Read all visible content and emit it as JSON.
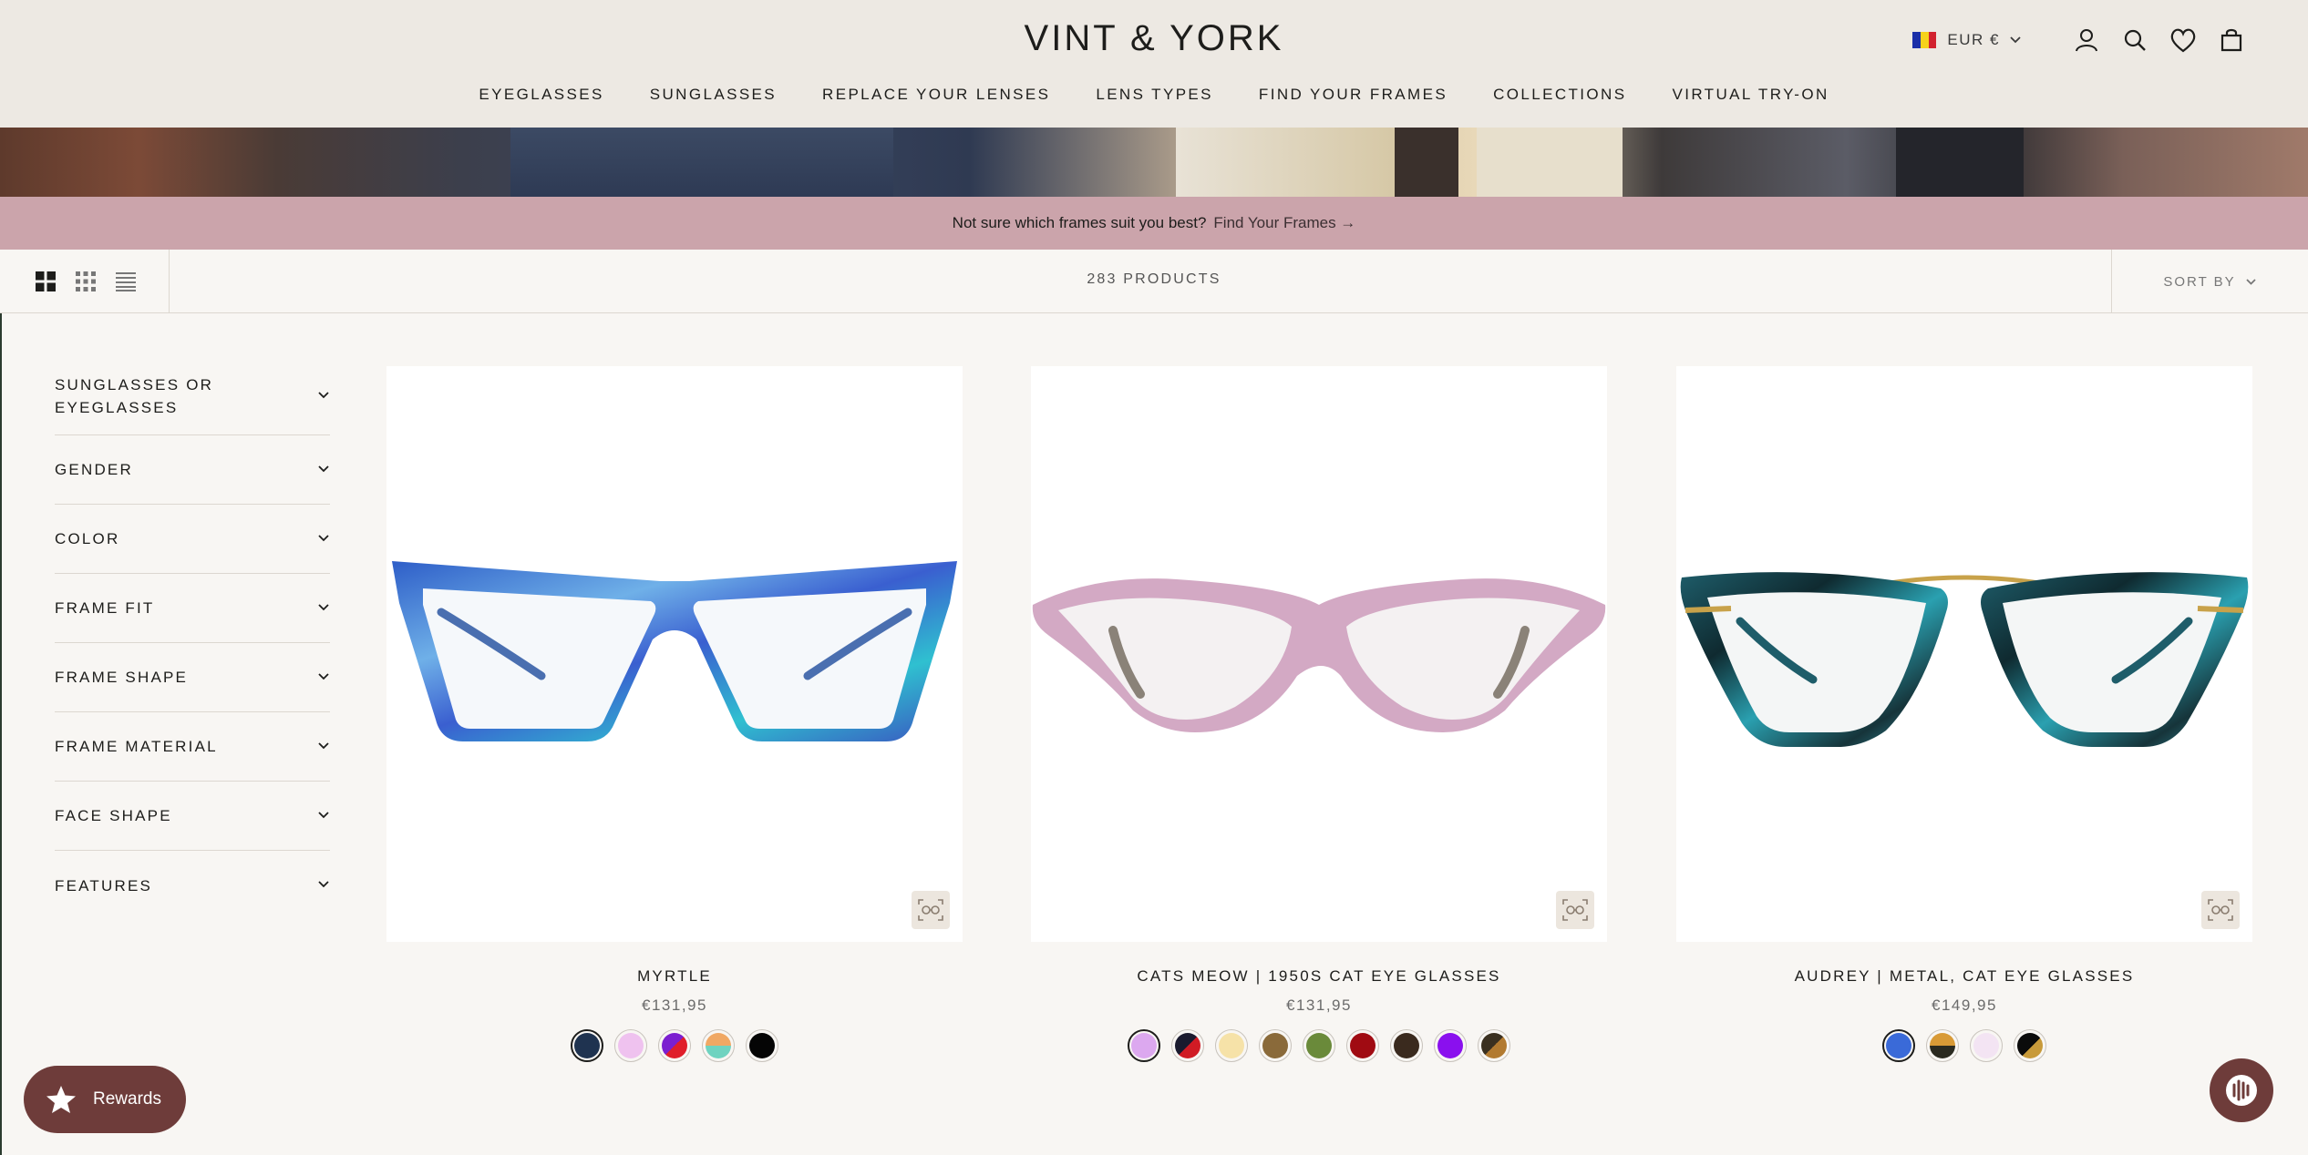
{
  "header": {
    "logo": "VINT & YORK",
    "currency": "EUR €",
    "flag_colors": [
      "#1b2fa8",
      "#f6d21c",
      "#d2222f"
    ],
    "nav": [
      "EYEGLASSES",
      "SUNGLASSES",
      "REPLACE YOUR LENSES",
      "LENS TYPES",
      "FIND YOUR FRAMES",
      "COLLECTIONS",
      "VIRTUAL TRY-ON"
    ],
    "icons": [
      "account-icon",
      "search-icon",
      "wishlist-heart-icon",
      "cart-bag-icon"
    ]
  },
  "promo": {
    "text": "Not sure which frames suit you best?",
    "link": "Find Your Frames →",
    "background": "#cba4ab"
  },
  "toolbar": {
    "view_modes": [
      "grid-large-icon",
      "grid-small-icon",
      "list-view-icon"
    ],
    "product_count": "283 PRODUCTS",
    "sort_label": "SORT BY"
  },
  "filters": [
    "SUNGLASSES OR EYEGLASSES",
    "GENDER",
    "COLOR",
    "FRAME FIT",
    "FRAME SHAPE",
    "FRAME MATERIAL",
    "FACE SHAPE",
    "FEATURES"
  ],
  "products": [
    {
      "name": "MYRTLE",
      "price": "€131,95",
      "swatches": [
        "#1f3350",
        "#efc2ef",
        "#7b1fd0|#e01e2a",
        "#f0a864|#6fd3c0",
        "#050505"
      ],
      "frame_color": "#3f7bd6"
    },
    {
      "name": "CATS MEOW | 1950S CAT EYE GLASSES",
      "price": "€131,95",
      "swatches": [
        "#dca8ef",
        "#1a1a2e|#d01b24",
        "#f6e2a8",
        "#8a6a3a",
        "#6a8a3a",
        "#a00b12",
        "#3a2a1e",
        "#8a10ee",
        "#3a3020|#b27a30"
      ],
      "frame_color": "#d3a9c4"
    },
    {
      "name": "AUDREY | METAL, CAT EYE GLASSES",
      "price": "€149,95",
      "swatches": [
        "#3a6ad8",
        "#d89a36|#2a2a20",
        "#f3e4f3",
        "#0b0b0b|#c89a3a"
      ],
      "frame_color": "#1e5d6a"
    }
  ],
  "rewards_label": "Rewards",
  "brand_color": "#6e3c3a"
}
